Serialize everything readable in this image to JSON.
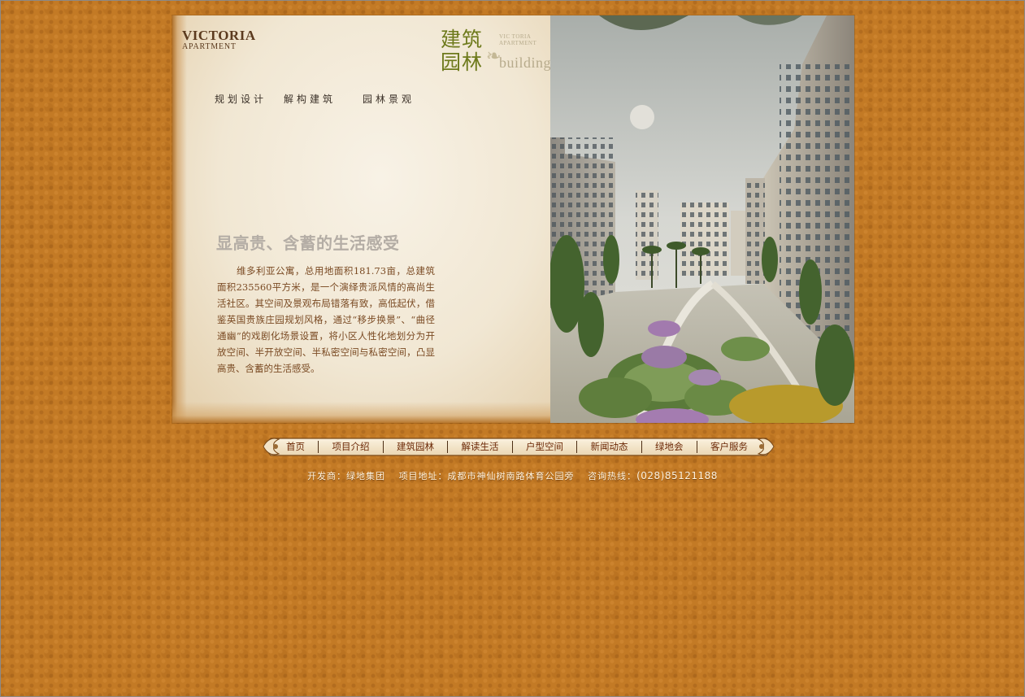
{
  "brand": {
    "logo_line1": "VICTORIA",
    "logo_line2": "APARTMENT"
  },
  "section": {
    "title_line1": "建筑",
    "title_line2": "园林",
    "english_small_1": "VIC TORIA",
    "english_small_2": "APARTMENT",
    "english_big": "building"
  },
  "subnav": {
    "items": [
      {
        "label": "规划设计"
      },
      {
        "label": "解构建筑"
      },
      {
        "label": "园林景观"
      }
    ]
  },
  "content": {
    "headline": "显高贵、含蓄的生活感受",
    "body": "维多利亚公寓，总用地面积181.73亩，总建筑面积235560平方米，是一个演绎贵派风情的高尚生活社区。其空间及景观布局错落有致，高低起伏，借鉴英国贵族庄园规划风格，通过“移步换景”、“曲径通幽”的戏剧化场景设置，将小区人性化地划分为开放空间、半开放空间、半私密空间与私密空间，凸显高贵、含蓄的生活感受。"
  },
  "mainnav": {
    "items": [
      {
        "label": "首页"
      },
      {
        "label": "项目介绍"
      },
      {
        "label": "建筑园林"
      },
      {
        "label": "解读生活"
      },
      {
        "label": "户型空间"
      },
      {
        "label": "新闻动态"
      },
      {
        "label": "绿地会"
      },
      {
        "label": "客户服务"
      }
    ]
  },
  "footer": {
    "developer": "开发商：绿地集团",
    "address": "项目地址：成都市神仙树南路体育公园旁",
    "hotline_label": "咨询热线：",
    "hotline_number": "(028)85121188"
  },
  "colors": {
    "page_bg": "#c37a25",
    "headline_gray": "#b4ada5",
    "body_brown": "#7a4a23",
    "section_green": "#6e7a1c",
    "nav_text": "#6d2a08"
  }
}
